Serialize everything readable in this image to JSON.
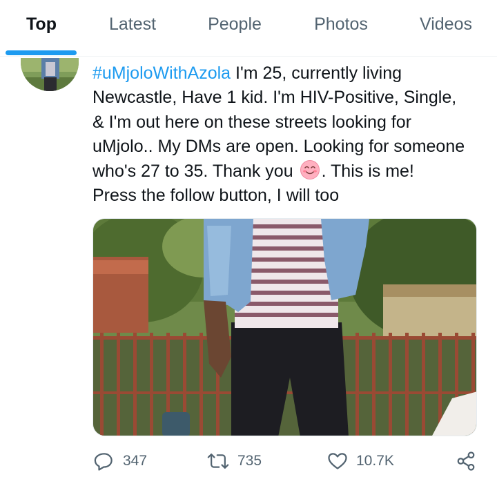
{
  "tabs": [
    {
      "label": "Top",
      "active": true
    },
    {
      "label": "Latest",
      "active": false
    },
    {
      "label": "People",
      "active": false
    },
    {
      "label": "Photos",
      "active": false
    },
    {
      "label": "Videos",
      "active": false
    }
  ],
  "tweet": {
    "hashtag": "#uMjoloWithAzola",
    "line1_rest": " I'm 25, currently living",
    "line2": "Newcastle, Have 1 kid. I'm HIV-Positive, Single,",
    "line3": "& I'm out here on these streets looking for",
    "line4": "uMjolo.. My DMs are open. Looking for someone",
    "line5_before_emoji": "who's 27 to 35. Thank you",
    "line5_after_emoji": ".  This is me!",
    "line6": "Press the follow button, I will too",
    "emoji_icon": "smiling-face-emoji-icon"
  },
  "actions": {
    "replies": "347",
    "retweets": "735",
    "likes": "10.7K",
    "reply_icon": "reply-icon",
    "retweet_icon": "retweet-icon",
    "like_icon": "heart-icon",
    "share_icon": "share-icon"
  },
  "colors": {
    "accent": "#1d9bf0",
    "text": "#0f1419",
    "muted": "#536471"
  }
}
